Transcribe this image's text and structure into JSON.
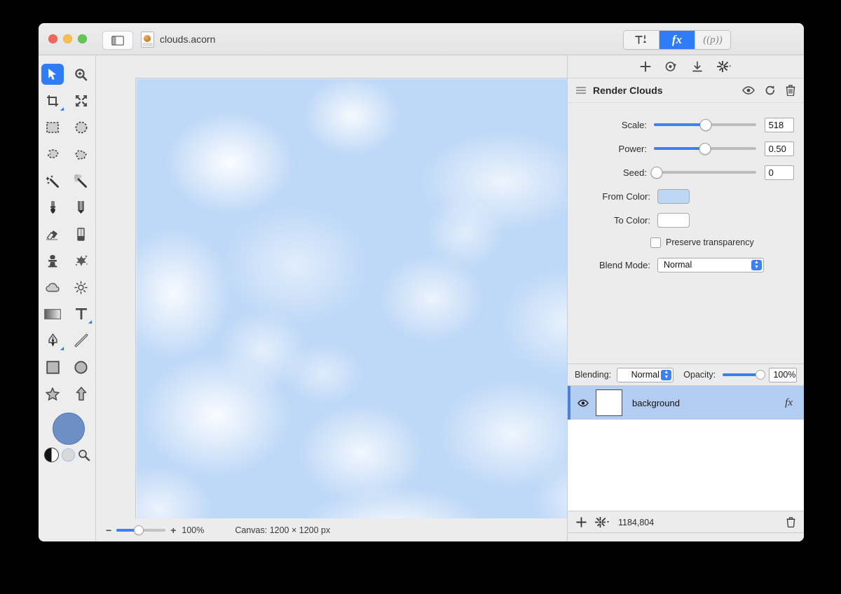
{
  "window": {
    "document_title": "clouds.acorn",
    "traffic_lights": [
      "close",
      "minimize",
      "zoom"
    ],
    "sidebar_toggle_icon": "sidebar-toggle-icon"
  },
  "mode_segments": [
    {
      "id": "tools",
      "label": "",
      "icon": "hammer-pen-icon",
      "active": false
    },
    {
      "id": "filters",
      "label": "fx",
      "icon": "fx-icon",
      "active": true
    },
    {
      "id": "palettes",
      "label": "((p))",
      "icon": "palette-icon",
      "active": false
    }
  ],
  "tools": [
    {
      "name": "move-tool",
      "icon": "arrow-cursor-icon",
      "active": true,
      "submenu": false
    },
    {
      "name": "zoom-tool",
      "icon": "magnifier-plus-icon",
      "active": false,
      "submenu": false
    },
    {
      "name": "crop-tool",
      "icon": "crop-icon",
      "active": false,
      "submenu": true
    },
    {
      "name": "transform-tool",
      "icon": "move-arrows-icon",
      "active": false,
      "submenu": false
    },
    {
      "name": "rectangular-selection-tool",
      "icon": "marquee-rect-icon",
      "active": false,
      "submenu": false
    },
    {
      "name": "elliptical-selection-tool",
      "icon": "marquee-ellipse-icon",
      "active": false,
      "submenu": false
    },
    {
      "name": "lasso-selection-tool",
      "icon": "lasso-icon",
      "active": false,
      "submenu": false
    },
    {
      "name": "polygon-selection-tool",
      "icon": "polygon-lasso-icon",
      "active": false,
      "submenu": false
    },
    {
      "name": "magic-wand-tool",
      "icon": "magic-wand-icon",
      "active": false,
      "submenu": false
    },
    {
      "name": "instant-alpha-tool",
      "icon": "magic-wand-dots-icon",
      "active": false,
      "submenu": false
    },
    {
      "name": "brush-tool",
      "icon": "paintbrush-icon",
      "active": false,
      "submenu": false
    },
    {
      "name": "pencil-tool",
      "icon": "pencil-icon",
      "active": false,
      "submenu": false
    },
    {
      "name": "eraser-tool",
      "icon": "eraser-icon",
      "active": false,
      "submenu": false
    },
    {
      "name": "smudge-tool",
      "icon": "smudge-stick-icon",
      "active": false,
      "submenu": false
    },
    {
      "name": "clone-stamp-tool",
      "icon": "clone-stamp-icon",
      "active": false,
      "submenu": false
    },
    {
      "name": "splatter-tool",
      "icon": "splatter-icon",
      "active": false,
      "submenu": false
    },
    {
      "name": "blur-tool",
      "icon": "cloud-icon",
      "active": false,
      "submenu": false
    },
    {
      "name": "dodge-burn-tool",
      "icon": "sun-icon",
      "active": false,
      "submenu": false
    },
    {
      "name": "gradient-tool",
      "icon": "gradient-rect-icon",
      "active": false,
      "submenu": false
    },
    {
      "name": "text-tool",
      "icon": "text-t-icon",
      "active": false,
      "submenu": true
    },
    {
      "name": "bezier-pen-tool",
      "icon": "fountain-pen-icon",
      "active": false,
      "submenu": true
    },
    {
      "name": "line-tool",
      "icon": "line-icon",
      "active": false,
      "submenu": false
    },
    {
      "name": "rectangle-shape-tool",
      "icon": "square-icon",
      "active": false,
      "submenu": false
    },
    {
      "name": "ellipse-shape-tool",
      "icon": "circle-icon",
      "active": false,
      "submenu": false
    },
    {
      "name": "star-shape-tool",
      "icon": "star-icon",
      "active": false,
      "submenu": false
    },
    {
      "name": "arrow-shape-tool",
      "icon": "arrow-up-icon",
      "active": false,
      "submenu": false
    }
  ],
  "colors": {
    "foreground_swatch": "#6e8fc4",
    "accent": "#2f7cf6",
    "canvas_base": "#bed8f7",
    "layer_selected": "#b3cdf2"
  },
  "filter_toolbar": [
    {
      "name": "add-filter-button",
      "icon": "plus-icon"
    },
    {
      "name": "filter-presets-button",
      "icon": "preset-disc-icon"
    },
    {
      "name": "download-filter-button",
      "icon": "download-arrow-icon"
    },
    {
      "name": "filter-settings-menu",
      "icon": "gear-dropdown-icon"
    }
  ],
  "filter": {
    "title": "Render Clouds",
    "drag_handle_icon": "hamburger-icon",
    "header_actions": [
      {
        "name": "toggle-filter-visibility",
        "icon": "eye-icon"
      },
      {
        "name": "reset-filter-button",
        "icon": "reset-arrow-icon"
      },
      {
        "name": "delete-filter-button",
        "icon": "trash-icon"
      }
    ],
    "params": [
      {
        "label": "Scale:",
        "value": "518",
        "slider_pct": 51,
        "type": "slider"
      },
      {
        "label": "Power:",
        "value": "0.50",
        "slider_pct": 50,
        "type": "slider"
      },
      {
        "label": "Seed:",
        "value": "0",
        "slider_pct": 0,
        "type": "slider"
      },
      {
        "label": "From Color:",
        "value": "",
        "color": "#bcd8f5",
        "type": "color"
      },
      {
        "label": "To Color:",
        "value": "",
        "color": "#ffffff",
        "type": "color"
      }
    ],
    "preserve_transparency": {
      "label": "Preserve transparency",
      "checked": false
    },
    "blend_mode": {
      "label": "Blend Mode:",
      "value": "Normal"
    }
  },
  "layers_panel": {
    "blending_label": "Blending:",
    "blending_value": "Normal",
    "opacity_label": "Opacity:",
    "opacity_value": "100%",
    "opacity_pct": 100,
    "layers": [
      {
        "name": "background",
        "visible": true,
        "has_fx": true,
        "selected": true
      }
    ],
    "footer": {
      "add_layer_icon": "plus-icon",
      "layer_actions_icon": "gear-dropdown-icon",
      "memory_usage": "1184,804",
      "delete_layer_icon": "trash-icon"
    }
  },
  "status_bar": {
    "zoom_out_icon": "minus-icon",
    "zoom_in_icon": "plus-icon",
    "zoom_level": "100%",
    "zoom_pct": 46,
    "canvas_info": "Canvas: 1200 × 1200 px"
  }
}
